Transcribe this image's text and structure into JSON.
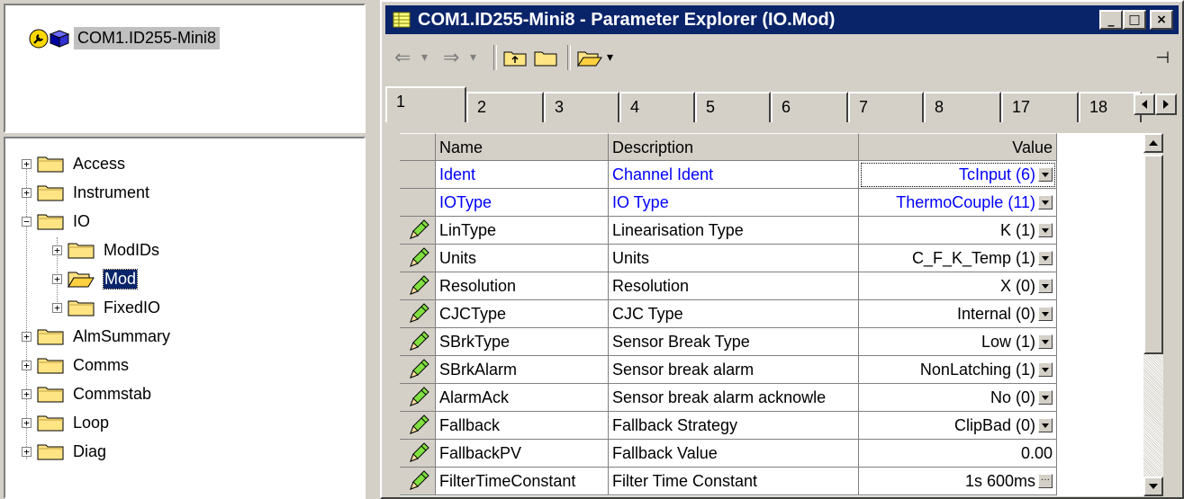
{
  "device_tree": {
    "label": "COM1.ID255-Mini8"
  },
  "tree": [
    {
      "label": "Access",
      "expander": "+"
    },
    {
      "label": "Instrument",
      "expander": "+"
    },
    {
      "label": "IO",
      "expander": "−"
    },
    {
      "label": "ModIDs",
      "expander": "+"
    },
    {
      "label": "Mod",
      "expander": "+",
      "selected": true
    },
    {
      "label": "FixedIO",
      "expander": "+"
    },
    {
      "label": "AlmSummary",
      "expander": "+"
    },
    {
      "label": "Comms",
      "expander": "+"
    },
    {
      "label": "Commstab",
      "expander": "+"
    },
    {
      "label": "Loop",
      "expander": "+"
    },
    {
      "label": "Diag",
      "expander": "+"
    }
  ],
  "window": {
    "title": "COM1.ID255-Mini8 - Parameter Explorer (IO.Mod)",
    "min_glyph": "_",
    "max_glyph": "□",
    "close_glyph": "×"
  },
  "toolbar": {
    "back_glyph": "⇐",
    "dropdown_glyph": "▾",
    "forward_glyph": "⇒",
    "pin_glyph": "⊣"
  },
  "tabs": [
    "1",
    "2",
    "3",
    "4",
    "5",
    "6",
    "7",
    "8",
    "17",
    "18"
  ],
  "grid": {
    "headers": {
      "name": "Name",
      "description": "Description",
      "value": "Value"
    },
    "rows": [
      {
        "name": "Ident",
        "description": "Channel Ident",
        "value": "TcInput (6)",
        "blue": true,
        "editable": false,
        "control": "dropdown",
        "focused": true
      },
      {
        "name": "IOType",
        "description": "IO Type",
        "value": "ThermoCouple (11)",
        "blue": true,
        "editable": false,
        "control": "dropdown"
      },
      {
        "name": "LinType",
        "description": "Linearisation Type",
        "value": "K (1)",
        "editable": true,
        "control": "dropdown"
      },
      {
        "name": "Units",
        "description": "Units",
        "value": "C_F_K_Temp (1)",
        "editable": true,
        "control": "dropdown"
      },
      {
        "name": "Resolution",
        "description": "Resolution",
        "value": "X (0)",
        "editable": true,
        "control": "dropdown"
      },
      {
        "name": "CJCType",
        "description": "CJC Type",
        "value": "Internal (0)",
        "editable": true,
        "control": "dropdown"
      },
      {
        "name": "SBrkType",
        "description": "Sensor Break Type",
        "value": "Low (1)",
        "editable": true,
        "control": "dropdown"
      },
      {
        "name": "SBrkAlarm",
        "description": "Sensor break alarm",
        "value": "NonLatching (1)",
        "editable": true,
        "control": "dropdown"
      },
      {
        "name": "AlarmAck",
        "description": "Sensor break alarm acknowle",
        "value": "No (0)",
        "editable": true,
        "control": "dropdown"
      },
      {
        "name": "Fallback",
        "description": "Fallback Strategy",
        "value": "ClipBad (0)",
        "editable": true,
        "control": "dropdown"
      },
      {
        "name": "FallbackPV",
        "description": "Fallback Value",
        "value": "0.00",
        "editable": true,
        "control": "none"
      },
      {
        "name": "FilterTimeConstant",
        "description": "Filter Time Constant",
        "value": "1s 600ms",
        "editable": true,
        "control": "ellipsis"
      }
    ]
  },
  "colors": {
    "titlebar": "#0a246a",
    "face": "#d4d0c8",
    "link_blue": "#0000ff",
    "folder": "#ffe484"
  },
  "icons": {
    "device": "wrench-and-device-icon",
    "folder": "folder-icon",
    "open_folder": "open-folder-icon",
    "edit": "pencil-icon",
    "grid_app": "grid-icon"
  }
}
